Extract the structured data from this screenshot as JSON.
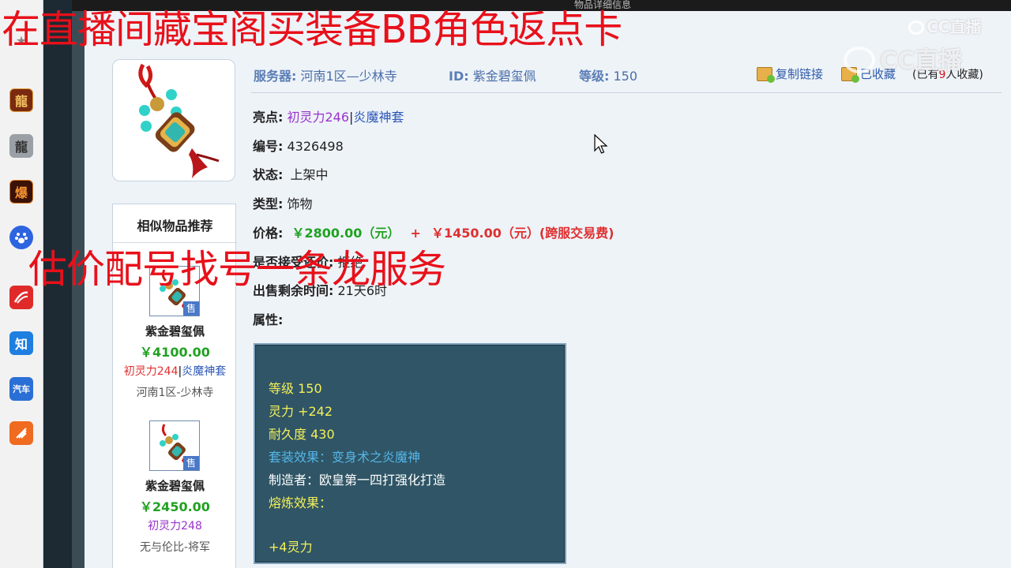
{
  "topbar": {
    "title": "物品详细信息"
  },
  "overlays": {
    "top_text": "在直播间藏宝阁买装备BB角色返点卡",
    "mid_text": "估价配号找号一条龙服务",
    "watermark_small": "CC直播",
    "watermark_large": "CC直播"
  },
  "meta": {
    "server_label": "服务器:",
    "server_value": "河南1区—少林寺",
    "id_label": "ID:",
    "id_value": "紫金碧玺佩",
    "level_label": "等级:",
    "level_value": "150"
  },
  "actions": {
    "copy_link": "复制链接",
    "favorited": "已收藏",
    "fav_prefix": "(已有",
    "fav_count": "9",
    "fav_suffix": "人收藏)"
  },
  "fields": {
    "highlight_label": "亮点:",
    "highlight_part1": "初灵力246",
    "highlight_sep": "|",
    "highlight_part2": "炎魔神套",
    "number_label": "编号:",
    "number_value": "4326498",
    "status_label": "状态:",
    "status_value": "上架中",
    "type_label": "类型:",
    "type_value": "饰物",
    "price_label": "价格:",
    "price_main": "￥2800.00（元）",
    "price_plus": "+",
    "price_fee": "￥1450.00（元）(跨服交易费)",
    "counter_label": "是否接受还价:",
    "counter_value": "拒绝",
    "remaining_label": "出售剩余时间:",
    "remaining_value": "21天6时",
    "attr_label": "属性:"
  },
  "similar": {
    "title": "相似物品推荐",
    "sold_tag": "售",
    "items": [
      {
        "name": "紫金碧玺佩",
        "price": "￥4100.00",
        "attr_a": "初灵力244",
        "attr_sep": "|",
        "attr_b": "炎魔神套",
        "server": "河南1区-少林寺"
      },
      {
        "name": "紫金碧玺佩",
        "price": "￥2450.00",
        "attr_a": "初灵力248",
        "server": "无与伦比-将军"
      }
    ]
  },
  "attributes": {
    "lines": [
      "等级 150",
      "灵力 +242",
      "耐久度 430",
      "套装效果：变身术之炎魔神",
      "制造者：欧皇第一四打强化打造",
      "熔炼效果：",
      "+4灵力"
    ]
  },
  "dock": {
    "icons": [
      "龍",
      "龍",
      "爆",
      "知",
      "汽车"
    ]
  },
  "colors": {
    "overlay_red": "#e8101a",
    "meta_blue": "#4a6ea8",
    "price_green": "#21a121",
    "price_red": "#e02f2f",
    "attr_panel": "#2f5566"
  }
}
